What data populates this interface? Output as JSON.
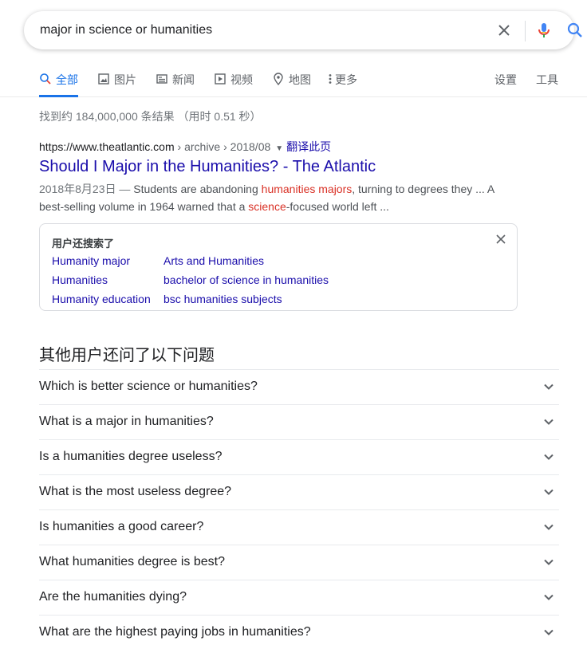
{
  "search": {
    "query": "major in science or humanities"
  },
  "tabs": [
    {
      "label": "全部",
      "icon": "search-icon"
    },
    {
      "label": "图片",
      "icon": "image-icon"
    },
    {
      "label": "新闻",
      "icon": "news-icon"
    },
    {
      "label": "视频",
      "icon": "video-icon"
    },
    {
      "label": "地图",
      "icon": "map-pin-icon"
    },
    {
      "label": "更多",
      "icon": "more-vert-icon"
    }
  ],
  "tools": {
    "settings": "设置",
    "tools": "工具"
  },
  "stats": "找到约 184,000,000 条结果 （用时 0.51 秒）",
  "result": {
    "domain": "https://www.theatlantic.com",
    "crumbs": " › archive › 2018/08",
    "translate": "翻译此页",
    "title": "Should I Major in the Humanities? - The Atlantic",
    "date": "2018年8月23日 — ",
    "snippet_1": "Students are abandoning ",
    "hl_1": "humanities majors",
    "snippet_2": ", turning to degrees they ... A best-selling volume in 1964 warned that a ",
    "hl_2": "science",
    "snippet_3": "-focused world left ..."
  },
  "related": {
    "title": "用户还搜索了",
    "links": [
      "Humanity major",
      "Arts and Humanities",
      "Humanities",
      "bachelor of science in humanities",
      "Humanity education",
      "bsc humanities subjects"
    ]
  },
  "paa": {
    "heading": "其他用户还问了以下问题",
    "questions": [
      "Which is better science or humanities?",
      "What is a major in humanities?",
      "Is a humanities degree useless?",
      "What is the most useless degree?",
      "Is humanities a good career?",
      "What humanities degree is best?",
      "Are the humanities dying?",
      "What are the highest paying jobs in humanities?"
    ]
  },
  "colors": {
    "link": "#1a0dab",
    "accent": "#1a73e8",
    "highlight": "#d93025"
  }
}
